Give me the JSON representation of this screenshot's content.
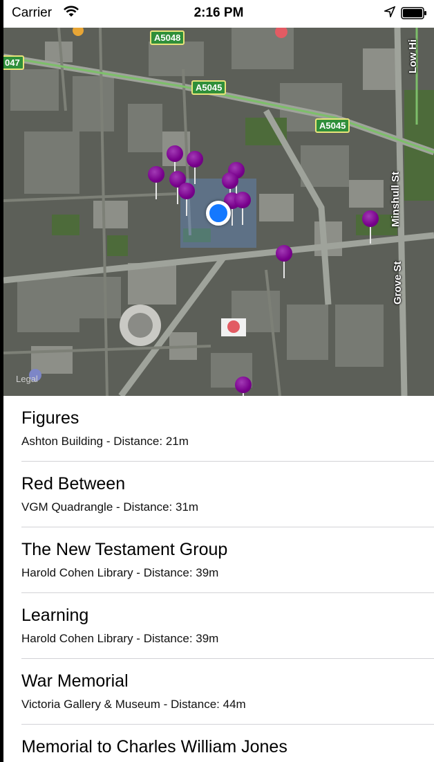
{
  "status_bar": {
    "carrier": "Carrier",
    "time": "2:16 PM"
  },
  "map": {
    "road_labels": [
      "A5048",
      "A5045",
      "A5045",
      "047"
    ],
    "street_labels": [
      "Minshull St",
      "Grove St",
      "Low Hi"
    ],
    "legal": "Legal",
    "colors": {
      "pin": "#7b0090",
      "user_location": "#1478ff",
      "road_label": "#2f8f3a"
    }
  },
  "items": [
    {
      "title": "Figures",
      "subtitle": "Ashton Building - Distance: 21m"
    },
    {
      "title": "Red Between",
      "subtitle": "VGM Quadrangle - Distance: 31m"
    },
    {
      "title": "The New Testament Group",
      "subtitle": "Harold Cohen Library - Distance: 39m"
    },
    {
      "title": "Learning",
      "subtitle": "Harold Cohen Library - Distance: 39m"
    },
    {
      "title": "War Memorial",
      "subtitle": "Victoria Gallery & Museum - Distance: 44m"
    },
    {
      "title": "Memorial to Charles William Jones",
      "subtitle": ""
    }
  ]
}
